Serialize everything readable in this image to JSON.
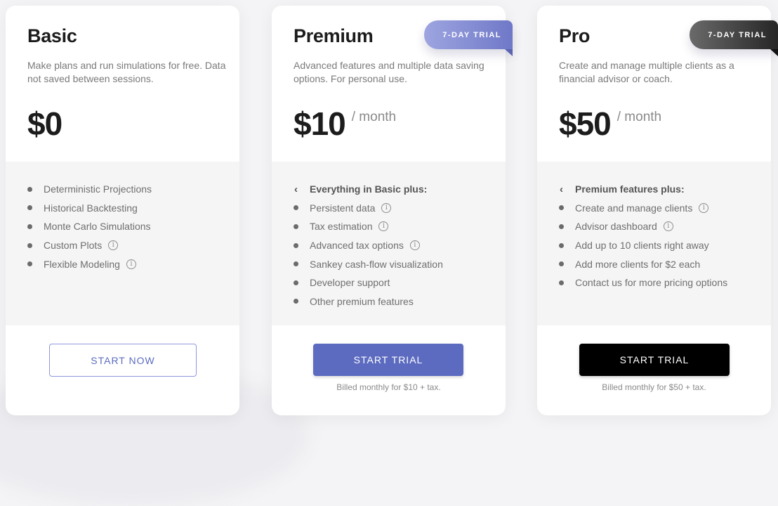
{
  "plans": [
    {
      "name": "Basic",
      "description": "Make plans and run simulations for free. Data not saved between sessions.",
      "price": "$0",
      "period": "",
      "badge": "",
      "features_heading": "",
      "features": [
        {
          "label": "Deterministic Projections",
          "info": false
        },
        {
          "label": "Historical Backtesting",
          "info": false
        },
        {
          "label": "Monte Carlo Simulations",
          "info": false
        },
        {
          "label": "Custom Plots",
          "info": true
        },
        {
          "label": "Flexible Modeling",
          "info": true
        }
      ],
      "button_label": "START NOW",
      "billing_note": ""
    },
    {
      "name": "Premium",
      "description": "Advanced features and multiple data saving options. For personal use.",
      "price": "$10",
      "period": "/ month",
      "badge": "7-DAY TRIAL",
      "features_heading": "Everything in Basic plus:",
      "features": [
        {
          "label": "Persistent data",
          "info": true
        },
        {
          "label": "Tax estimation",
          "info": true
        },
        {
          "label": "Advanced tax options",
          "info": true
        },
        {
          "label": "Sankey cash-flow visualization",
          "info": false
        },
        {
          "label": "Developer support",
          "info": false
        },
        {
          "label": "Other premium features",
          "info": false
        }
      ],
      "button_label": "START TRIAL",
      "billing_note": "Billed monthly for $10 + tax."
    },
    {
      "name": "Pro",
      "description": "Create and manage multiple clients as a financial advisor or coach.",
      "price": "$50",
      "period": "/ month",
      "badge": "7-DAY TRIAL",
      "features_heading": "Premium features plus:",
      "features": [
        {
          "label": "Create and manage clients",
          "info": true
        },
        {
          "label": "Advisor dashboard",
          "info": true
        },
        {
          "label": "Add up to 10 clients right away",
          "info": false
        },
        {
          "label": "Add more clients for $2 each",
          "info": false
        },
        {
          "label": "Contact us for more pricing options",
          "info": false
        }
      ],
      "button_label": "START TRIAL",
      "billing_note": "Billed monthly for $50 + tax."
    }
  ],
  "icons": {
    "info": "i",
    "chevron": "‹"
  },
  "colors": {
    "accent": "#5c6bc0",
    "dark_button": "#000000",
    "features_bg": "#f5f5f5"
  }
}
